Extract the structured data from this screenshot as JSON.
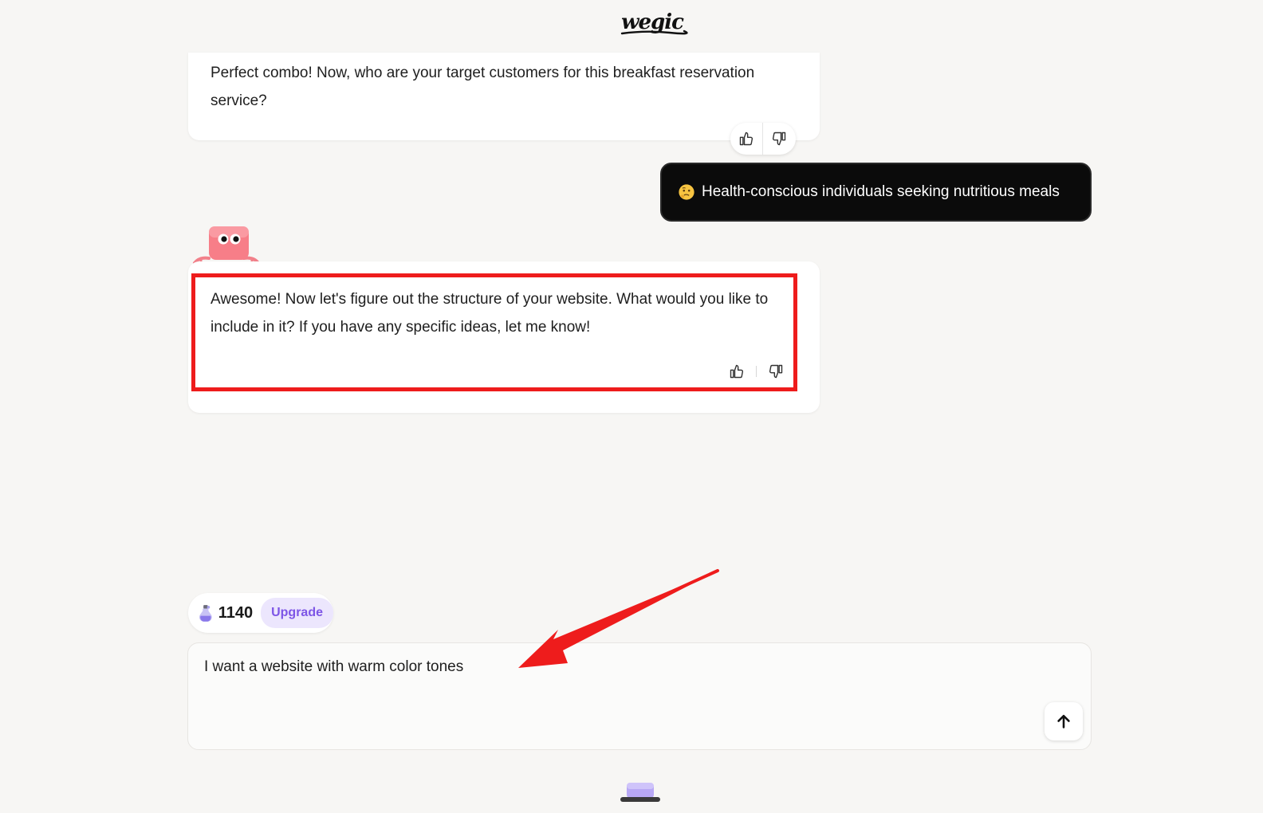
{
  "app": {
    "logo_text": "wegic",
    "logo_icon": "wegic-logo-icon"
  },
  "colors": {
    "background": "#f7f6f4",
    "user_bubble": "#0b0b0b",
    "highlight": "#ee1c1c",
    "upgrade_bg": "#ece6fd",
    "upgrade_text": "#7d55e6"
  },
  "chat": {
    "messages": [
      {
        "role": "assistant",
        "text": "Perfect combo! Now, who are your target customers for this breakfast reservation service?"
      },
      {
        "role": "user",
        "emoji_icon": "thinking-face-icon",
        "text": "Health-conscious individuals seeking nutritious meals"
      },
      {
        "role": "assistant",
        "text": "Awesome! Now let's figure out the structure of your website. What would you like to include in it? If you have any specific ideas, let me know!"
      }
    ]
  },
  "credits": {
    "icon": "potion-icon",
    "count": "1140",
    "upgrade_label": "Upgrade"
  },
  "composer": {
    "value": "I want a website with warm color tones",
    "send_icon": "arrow-up-icon"
  }
}
